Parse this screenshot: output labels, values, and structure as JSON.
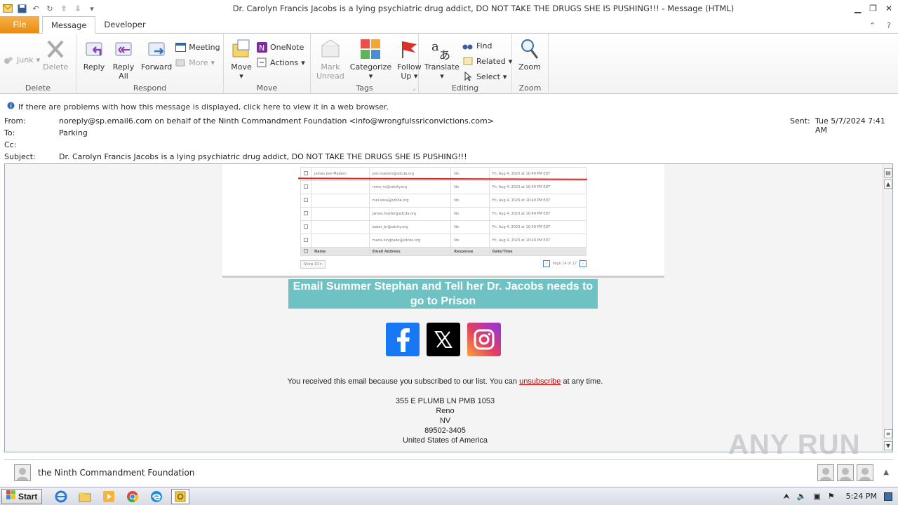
{
  "window": {
    "title": "Dr. Carolyn Francis Jacobs is a lying psychiatric drug addict, DO NOT TAKE THE DRUGS SHE IS PUSHING!!!  -  Message (HTML)"
  },
  "tabs": [
    "File",
    "Message",
    "Developer"
  ],
  "ribbon": {
    "delete": {
      "junk": "Junk",
      "delete": "Delete",
      "label": "Delete"
    },
    "respond": {
      "reply": "Reply",
      "reply_all_1": "Reply",
      "reply_all_2": "All",
      "forward": "Forward",
      "meeting": "Meeting",
      "more": "More",
      "label": "Respond"
    },
    "move": {
      "move": "Move",
      "onenote": "OneNote",
      "actions": "Actions",
      "label": "Move"
    },
    "tags": {
      "mark_1": "Mark",
      "mark_2": "Unread",
      "categorize": "Categorize",
      "follow_1": "Follow",
      "follow_2": "Up",
      "label": "Tags"
    },
    "editing": {
      "translate": "Translate",
      "find": "Find",
      "related": "Related",
      "select": "Select",
      "label": "Editing"
    },
    "zoom": {
      "zoom": "Zoom",
      "label": "Zoom"
    }
  },
  "infobar": "If there are problems with how this message is displayed, click here to view it in a web browser.",
  "header": {
    "from_label": "From:",
    "from": "noreply@sp.email6.com on behalf of the Ninth Commandment Foundation <info@wrongfulssriconvictions.com>",
    "to_label": "To:",
    "to": "Parking",
    "cc_label": "Cc:",
    "subject_label": "Subject:",
    "subject": "Dr. Carolyn Francis Jacobs is a lying psychiatric drug addict, DO NOT TAKE THE DRUGS SHE IS PUSHING!!!",
    "sent_label": "Sent:",
    "sent": "Tue 5/7/2024 7:41 AM"
  },
  "embedded_table": {
    "rows": [
      {
        "name": "James Joel Madero",
        "email": "joel.madero@sdcda.org",
        "response": "No",
        "date": "Fri, Aug 4, 2023 at 10:49 PM EDT"
      },
      {
        "name": "",
        "email": "romo_tx@sdcity.org",
        "response": "No",
        "date": "Fri, Aug 4, 2023 at 10:49 PM EDT"
      },
      {
        "name": "",
        "email": "mel.sosa@sdcda.org",
        "response": "No",
        "date": "Fri, Aug 4, 2023 at 10:49 PM EDT"
      },
      {
        "name": "",
        "email": "james.hoefer@sdcda.org",
        "response": "No",
        "date": "Fri, Aug 4, 2023 at 10:49 PM EDT"
      },
      {
        "name": "",
        "email": "baker_br@sdcity.org",
        "response": "No",
        "date": "Fri, Aug 4, 2023 at 10:49 PM EDT"
      },
      {
        "name": "",
        "email": "maria.kingkade@sdcda.org",
        "response": "No",
        "date": "Fri, Aug 4, 2023 at 10:49 PM EDT"
      }
    ],
    "headers": [
      "Name",
      "Email Address",
      "Response",
      "Date/Time"
    ],
    "show": "Show 10",
    "page": "Page 14 of 17"
  },
  "banner": "Email Summer Stephan and Tell her Dr. Jacobs needs to go to Prison",
  "footer": {
    "received_pre": "You received this email because you subscribed to our list. You can ",
    "unsubscribe": "unsubscribe",
    "received_post": " at any time.",
    "address1": "355 E PLUMB LN PMB 1053",
    "city": "Reno",
    "state": "NV",
    "zip": "89502-3405",
    "country": "United States of America"
  },
  "people_pane": {
    "name": "the Ninth Commandment Foundation"
  },
  "taskbar": {
    "start": "Start",
    "time": "5:24 PM"
  },
  "watermark": "ANY RUN"
}
